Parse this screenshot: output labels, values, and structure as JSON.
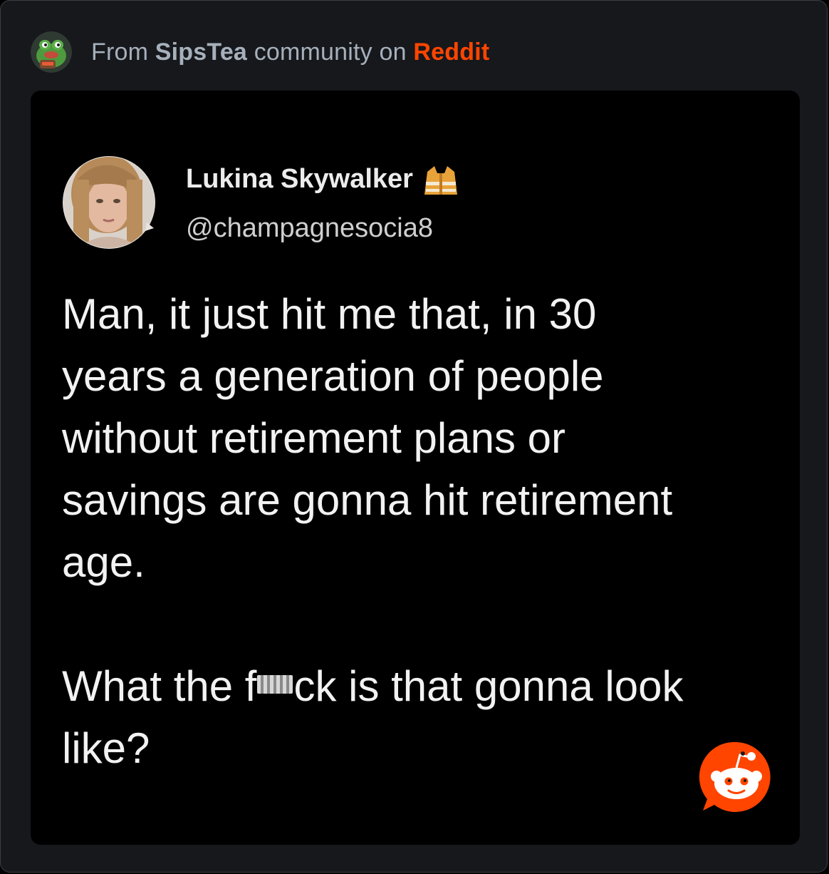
{
  "header": {
    "prefix": "From ",
    "community": "SipsTea",
    "middle": " community on ",
    "platform": "Reddit",
    "community_avatar_icon": "sipstea-frog-icon",
    "platform_color": "#ff4500"
  },
  "tweet": {
    "author_name": "Lukina Skywalker",
    "badge_icon": "safety-vest-icon",
    "author_handle": "@champagnesocia8",
    "paragraph1_lines": [
      "Man, it just hit me that, in 30",
      "years a generation of people",
      "without retirement plans or",
      "savings are gonna hit retirement",
      "age."
    ],
    "paragraph2_line1_before": "What the f",
    "paragraph2_line1_after": "ck is that gonna look",
    "paragraph2_line2": "like?"
  },
  "watermark": {
    "icon": "reddit-snoo-icon"
  }
}
